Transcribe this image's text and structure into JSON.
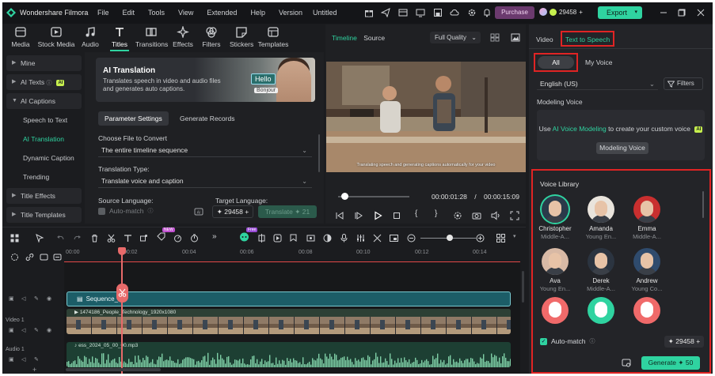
{
  "app": {
    "name": "Wondershare Filmora",
    "document": "Untitled"
  },
  "menu": [
    "File",
    "Edit",
    "Tools",
    "View",
    "Extended",
    "Help",
    "Version"
  ],
  "titlebar": {
    "purchase": "Purchase",
    "credits": "29458",
    "export": "Export"
  },
  "toolbar_tabs": [
    {
      "label": "Media",
      "icon": "media-icon"
    },
    {
      "label": "Stock Media",
      "icon": "stock-media-icon"
    },
    {
      "label": "Audio",
      "icon": "audio-icon"
    },
    {
      "label": "Titles",
      "icon": "titles-icon"
    },
    {
      "label": "Transitions",
      "icon": "transitions-icon"
    },
    {
      "label": "Effects",
      "icon": "effects-icon"
    },
    {
      "label": "Filters",
      "icon": "filters-icon"
    },
    {
      "label": "Stickers",
      "icon": "stickers-icon"
    },
    {
      "label": "Templates",
      "icon": "templates-icon"
    }
  ],
  "active_tab": "Titles",
  "left_nav": {
    "mine": "Mine",
    "ai_texts": "AI Texts",
    "ai_badge": "AI",
    "ai_captions": "AI Captions",
    "speech_to_text": "Speech to Text",
    "ai_translation": "AI Translation",
    "dynamic_caption": "Dynamic Caption",
    "trending": "Trending",
    "title_effects": "Title Effects",
    "title_templates": "Title Templates"
  },
  "ai_panel": {
    "banner_title": "AI Translation",
    "banner_desc": "Translates speech in video and audio files and generates auto captions.",
    "banner_hello": "Hello",
    "banner_bonjour": "Bonjour",
    "tab_params": "Parameter Settings",
    "tab_records": "Generate Records",
    "choose_label": "Choose File to Convert",
    "choose_value": "The entire timeline sequence",
    "type_label": "Translation Type:",
    "type_value": "Translate voice and caption",
    "source_label": "Source Language:",
    "target_label": "Target Language:",
    "auto_match": "Auto-match",
    "credits": "29458",
    "translate_btn": "Translate",
    "translate_cost": "21"
  },
  "preview": {
    "tab_timeline": "Timeline",
    "tab_source": "Source",
    "quality": "Full Quality",
    "subtitle": "Translating speech and generating captions automatically for your video",
    "time_current": "00:00:01:28",
    "time_sep": "/",
    "time_total": "00:00:15:09"
  },
  "right_panel": {
    "tab_video": "Video",
    "tab_tts": "Text to Speech",
    "filter_all": "All",
    "filter_my": "My Voice",
    "language": "English (US)",
    "filters": "Filters",
    "modeling_title": "Modeling Voice",
    "modeling_pre": "Use",
    "modeling_link": "AI Voice Modeling",
    "modeling_post": "to create your custom voice",
    "modeling_badge": "AI",
    "modeling_btn": "Modeling Voice",
    "library_title": "Voice Library",
    "auto_match": "Auto-match",
    "credits": "29458",
    "generate": "Generate",
    "generate_cost": "50"
  },
  "voices": [
    {
      "name": "Christopher",
      "desc": "Middle-A...",
      "tone": "#2a3a4a",
      "selected": true
    },
    {
      "name": "Amanda",
      "desc": "Young En...",
      "tone": "#e9e4dc"
    },
    {
      "name": "Emma",
      "desc": "Middle-A...",
      "tone": "#c92f2f"
    },
    {
      "name": "Ava",
      "desc": "Young En...",
      "tone": "#d8b9a5"
    },
    {
      "name": "Derek",
      "desc": "Middle-A...",
      "tone": "#2b3440"
    },
    {
      "name": "Andrew",
      "desc": "Young Co...",
      "tone": "#2f4b6d"
    },
    {
      "name": "",
      "desc": "",
      "tone": "#f06a6a"
    },
    {
      "name": "",
      "desc": "",
      "tone": "#2fd3a0"
    },
    {
      "name": "",
      "desc": "",
      "tone": "#f06a6a"
    }
  ],
  "timeline": {
    "ruler": [
      "00:00",
      "00:02",
      "00:04",
      "00:06",
      "00:08",
      "00:10",
      "00:12",
      "00:14"
    ],
    "sequence_clip": "Sequence_6",
    "video_clip": "1474186_People_Technology_1920x1080",
    "audio_clip": "ess_2024_05_00_00.mp3",
    "video_track": "Video 1",
    "audio_track": "Audio 1",
    "new_badge": "NEW",
    "free_badge": "Free"
  },
  "colors": {
    "accent": "#2fd3a0",
    "highlight": "#e02424",
    "playhead": "#e86a6a"
  }
}
